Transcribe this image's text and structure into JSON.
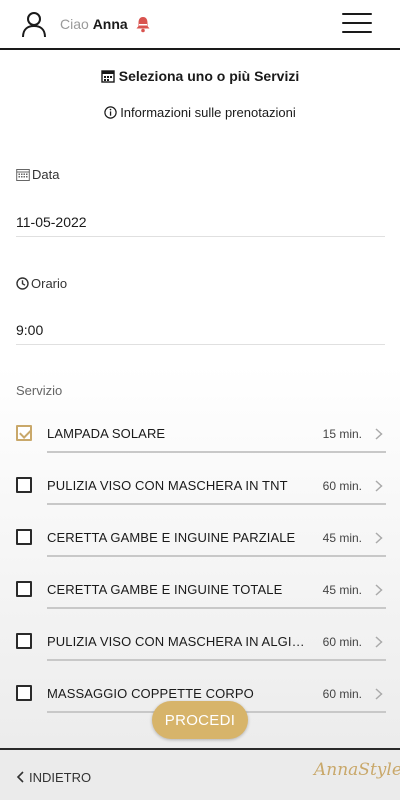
{
  "header": {
    "greeting": "Ciao",
    "user_name": "Anna"
  },
  "main": {
    "title": "Seleziona uno o più Servizi",
    "info_link": "Informazioni sulle prenotazioni",
    "date": {
      "label": "Data",
      "value": "11-05-2022"
    },
    "time": {
      "label": "Orario",
      "value": "9:00"
    },
    "services_label": "Servizio",
    "services": [
      {
        "name": "LAMPADA SOLARE",
        "duration": "15 min.",
        "checked": true
      },
      {
        "name": "PULIZIA VISO CON MASCHERA IN TNT",
        "duration": "60 min.",
        "checked": false
      },
      {
        "name": "CERETTA GAMBE E INGUINE PARZIALE",
        "duration": "45 min.",
        "checked": false
      },
      {
        "name": "CERETTA GAMBE E INGUINE TOTALE",
        "duration": "45 min.",
        "checked": false
      },
      {
        "name": "PULIZIA VISO CON MASCHERA IN ALGINATO",
        "duration": "60 min.",
        "checked": false
      },
      {
        "name": "MASSAGGIO COPPETTE CORPO",
        "duration": "60 min.",
        "checked": false
      }
    ],
    "proceed_label": "PROCEDI"
  },
  "footer": {
    "back_label": "INDIETRO",
    "logo_text": "AnnaStyle"
  },
  "colors": {
    "accent_gold": "#d7b46a",
    "checkbox_checked": "#c9a86a",
    "bell_red": "#d9534f"
  },
  "icons": [
    "user-icon",
    "bell-icon",
    "hamburger-menu-icon",
    "calendar-icon",
    "info-icon",
    "clock-icon",
    "chevron-right-icon",
    "chevron-left-icon"
  ]
}
